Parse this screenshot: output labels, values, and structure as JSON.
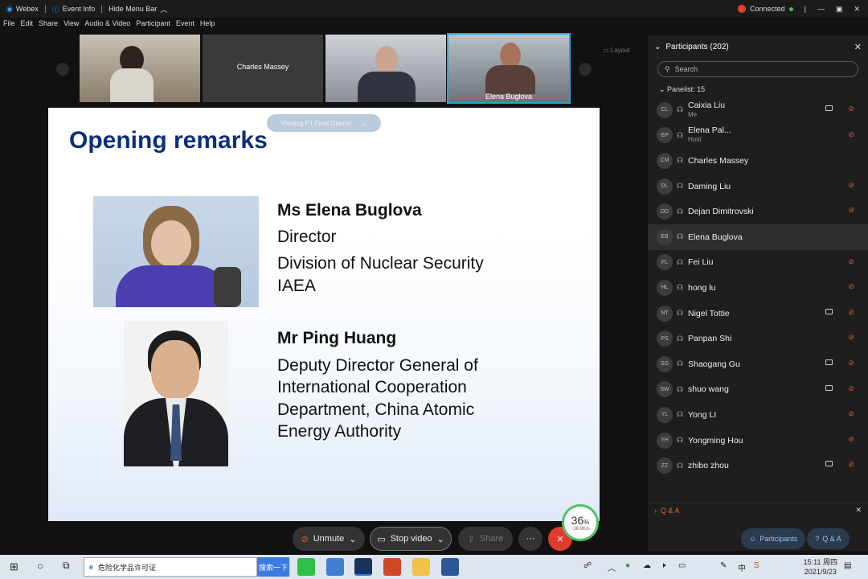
{
  "titlebar": {
    "app": "Webex",
    "event_info": "Event Info",
    "hide_menu": "Hide Menu Bar",
    "status": "Connected"
  },
  "menu": [
    "File",
    "Edit",
    "Share",
    "View",
    "Audio & Video",
    "Participant",
    "Event",
    "Help"
  ],
  "video_strip": {
    "tiles": [
      {
        "label": ""
      },
      {
        "label": "Charles Massey"
      },
      {
        "label": ""
      },
      {
        "label": "Elena Buglova"
      }
    ],
    "layout_label": "Layout"
  },
  "slide": {
    "viewing_label": "Viewing P1 Final Openin...",
    "title": "Opening remarks",
    "logo_text": "IAEA",
    "person1": {
      "name": "Ms Elena Buglova",
      "lines": [
        "Director",
        "Division of Nuclear Security",
        "IAEA"
      ]
    },
    "person2": {
      "name": "Mr Ping Huang",
      "lines": [
        "Deputy Director General of",
        "International Cooperation",
        "Department, China Atomic",
        "Energy Authority"
      ]
    }
  },
  "panel": {
    "title": "Participants (202)",
    "search_placeholder": "Search",
    "section": "Panelist: 15",
    "participants": [
      {
        "initials": "CL",
        "name": "Caixia Liu",
        "sub": "Me",
        "cam": true
      },
      {
        "initials": "EP",
        "name": "Elena Pal...",
        "sub": "Host",
        "cam": false
      },
      {
        "initials": "CM",
        "name": "Charles Massey",
        "sub": "",
        "cam": false,
        "mic": false
      },
      {
        "initials": "DL",
        "name": "Daming Liu",
        "sub": "",
        "cam": false
      },
      {
        "initials": "DD",
        "name": "Dejan Dimitrovski",
        "sub": "",
        "cam": false
      },
      {
        "initials": "EB",
        "name": "Elena Buglova",
        "sub": "",
        "cam": false,
        "mic": false
      },
      {
        "initials": "FL",
        "name": "Fei Liu",
        "sub": "",
        "cam": false
      },
      {
        "initials": "HL",
        "name": "hong lu",
        "sub": "",
        "cam": false
      },
      {
        "initials": "NT",
        "name": "Nigel Tottie",
        "sub": "",
        "cam": true
      },
      {
        "initials": "PS",
        "name": "Panpan Shi",
        "sub": "",
        "cam": false
      },
      {
        "initials": "SG",
        "name": "Shaogang Gu",
        "sub": "",
        "cam": true
      },
      {
        "initials": "SW",
        "name": "shuo wang",
        "sub": "",
        "cam": true
      },
      {
        "initials": "YL",
        "name": "Yong LI",
        "sub": "",
        "cam": false
      },
      {
        "initials": "YH",
        "name": "Yongming Hou",
        "sub": "",
        "cam": false
      },
      {
        "initials": "ZZ",
        "name": "zhibo zhou",
        "sub": "",
        "cam": true
      }
    ],
    "qa_label": "Q & A"
  },
  "controls": {
    "unmute": "Unmute",
    "stop_video": "Stop video",
    "share": "Share",
    "more": "···",
    "speed_pct": "36",
    "speed_pct_unit": "%",
    "speed_rate": "↑36.9K/s"
  },
  "bottom_tabs": {
    "participants": "Participants",
    "qa": "Q & A"
  },
  "taskbar": {
    "search_text": "危险化学品许可证",
    "search_button": "搜索一下",
    "time": "15:11 周四",
    "date": "2021/9/23",
    "ime": "中"
  }
}
